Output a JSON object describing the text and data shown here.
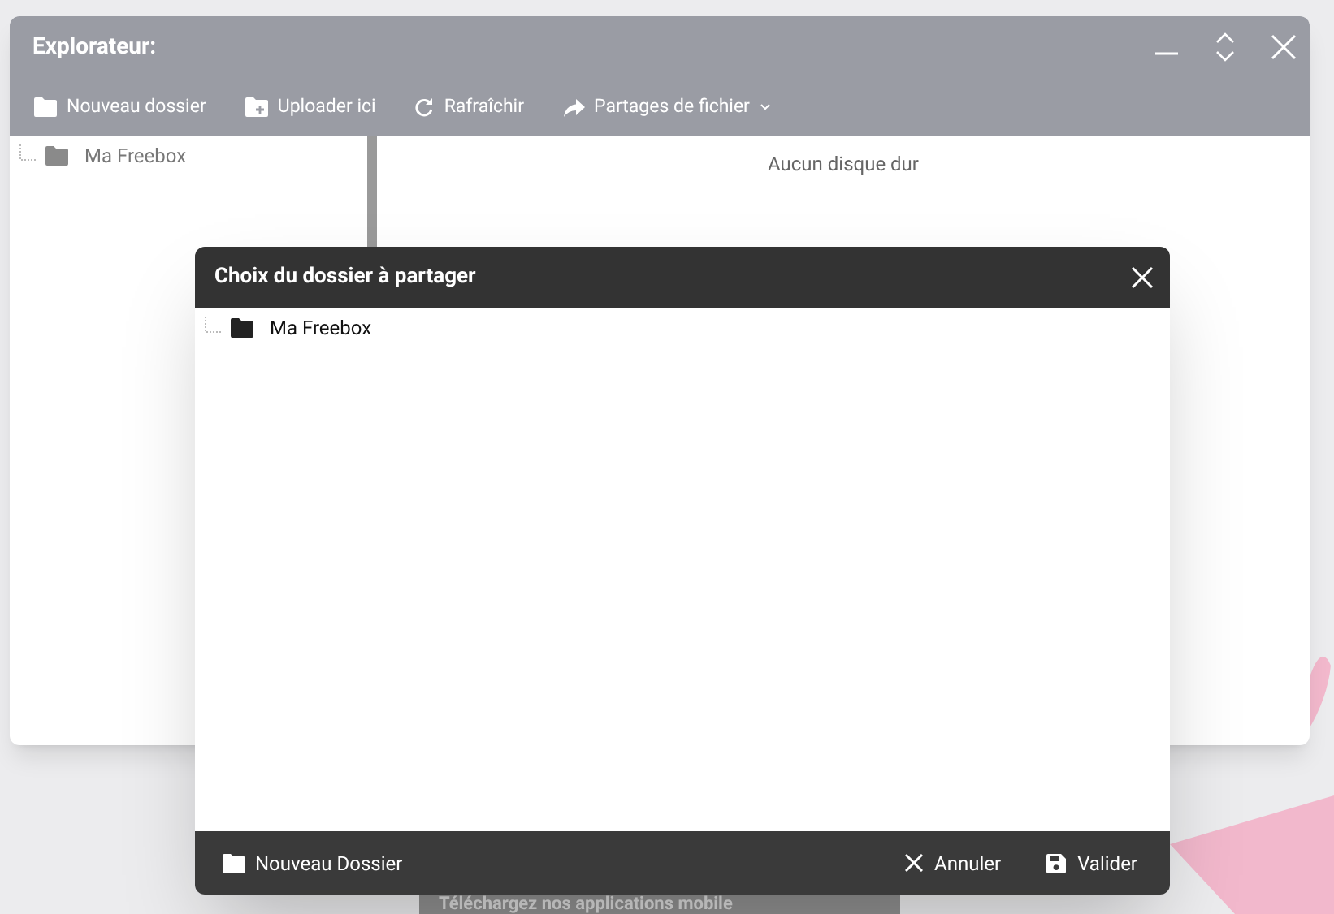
{
  "explorer": {
    "title": "Explorateur:",
    "toolbar": [
      {
        "label": "Nouveau dossier",
        "kind": "folder",
        "dropdown": false
      },
      {
        "label": "Uploader ici",
        "kind": "upload",
        "dropdown": false
      },
      {
        "label": "Rafraîchir",
        "kind": "refresh",
        "dropdown": false
      },
      {
        "label": "Partages de fichier",
        "kind": "share",
        "dropdown": true
      }
    ],
    "tree": [
      {
        "label": "Ma Freebox"
      }
    ],
    "message": "Aucun disque dur"
  },
  "dialog": {
    "title": "Choix du dossier à partager",
    "tree": [
      {
        "label": "Ma Freebox"
      }
    ],
    "footer_action": {
      "label": "Nouveau Dossier"
    },
    "buttons": [
      {
        "label": "Annuler",
        "kind": "cancel"
      },
      {
        "label": "Valider",
        "kind": "save"
      }
    ]
  },
  "banner": {
    "text": "Téléchargez nos applications mobile"
  }
}
